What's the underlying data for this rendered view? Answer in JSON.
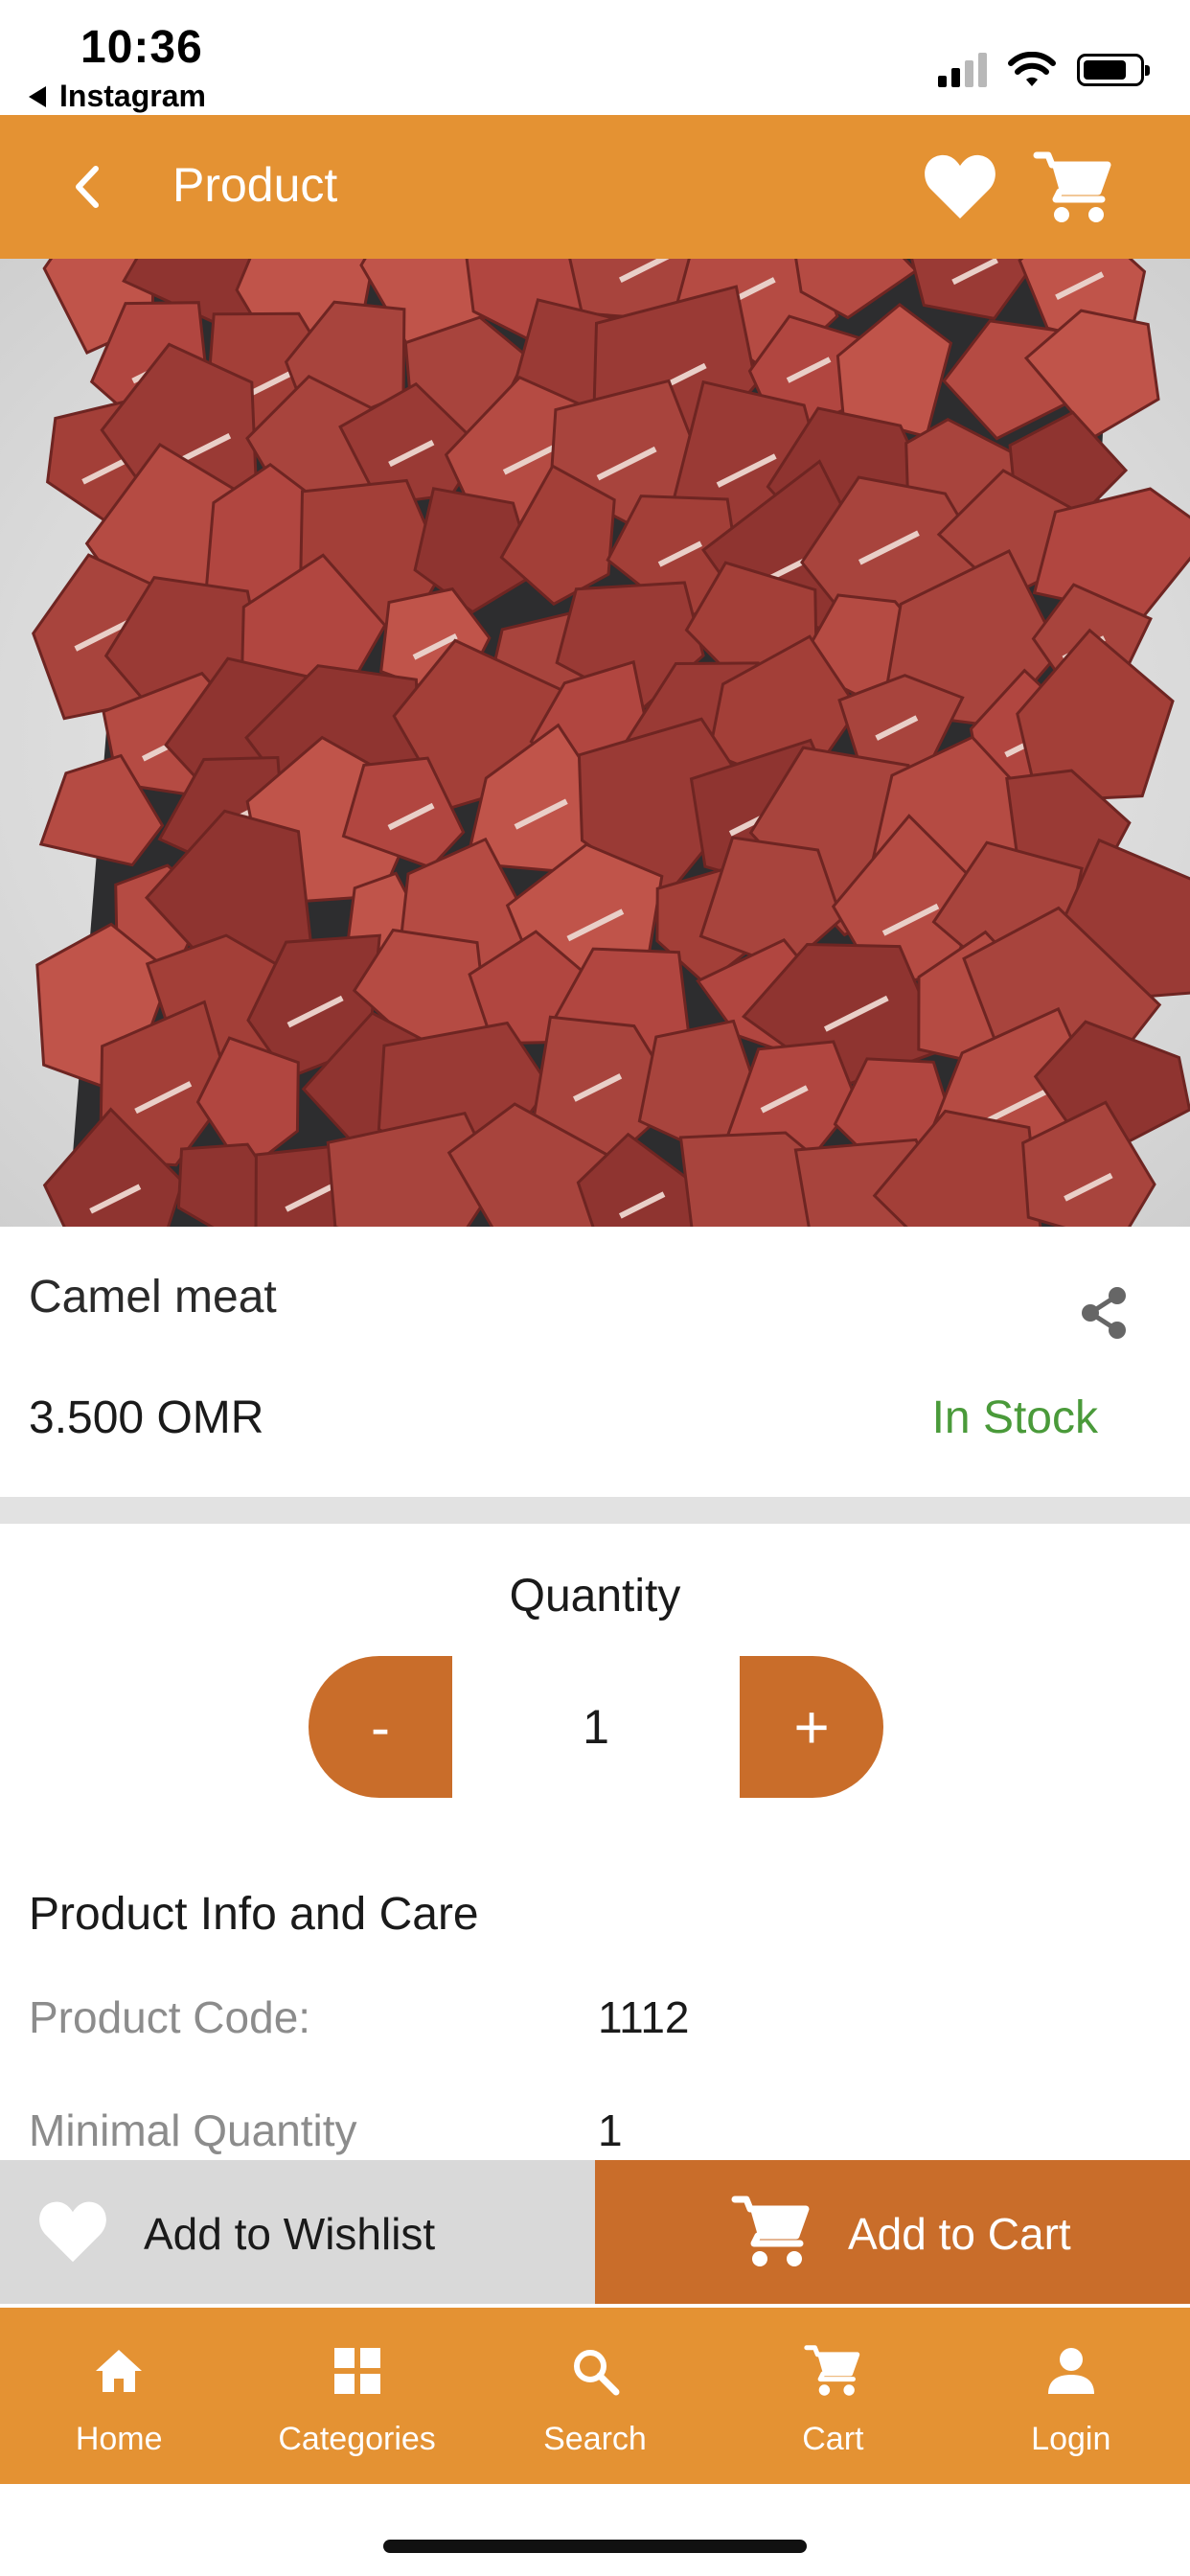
{
  "status_bar": {
    "time": "10:36",
    "back_app": "Instagram"
  },
  "header": {
    "title": "Product",
    "icons": [
      "back-arrow-icon",
      "heart-icon",
      "cart-icon"
    ]
  },
  "product": {
    "name": "Camel meat",
    "price": "3.500 OMR",
    "stock_status": "In Stock",
    "image": "camel-meat-cubes-photo"
  },
  "quantity": {
    "label": "Quantity",
    "minus_label": "-",
    "value": "1",
    "plus_label": "+"
  },
  "info": {
    "title": "Product Info and Care",
    "rows": [
      {
        "label": "Product Code:",
        "value": "1112"
      },
      {
        "label": "Minimal Quantity",
        "value": "1"
      }
    ]
  },
  "actions": {
    "wishlist_label": "Add to Wishlist",
    "cart_label": "Add to Cart"
  },
  "bottom_nav": {
    "items": [
      {
        "label": "Home",
        "icon": "home-icon"
      },
      {
        "label": "Categories",
        "icon": "grid-icon"
      },
      {
        "label": "Search",
        "icon": "search-icon"
      },
      {
        "label": "Cart",
        "icon": "cart-icon"
      },
      {
        "label": "Login",
        "icon": "user-icon"
      }
    ]
  },
  "colors": {
    "header_orange": "#e49233",
    "button_orange": "#c96d2a",
    "stock_green": "#4a9a3a",
    "wishlist_gray": "#d9d9d9"
  }
}
